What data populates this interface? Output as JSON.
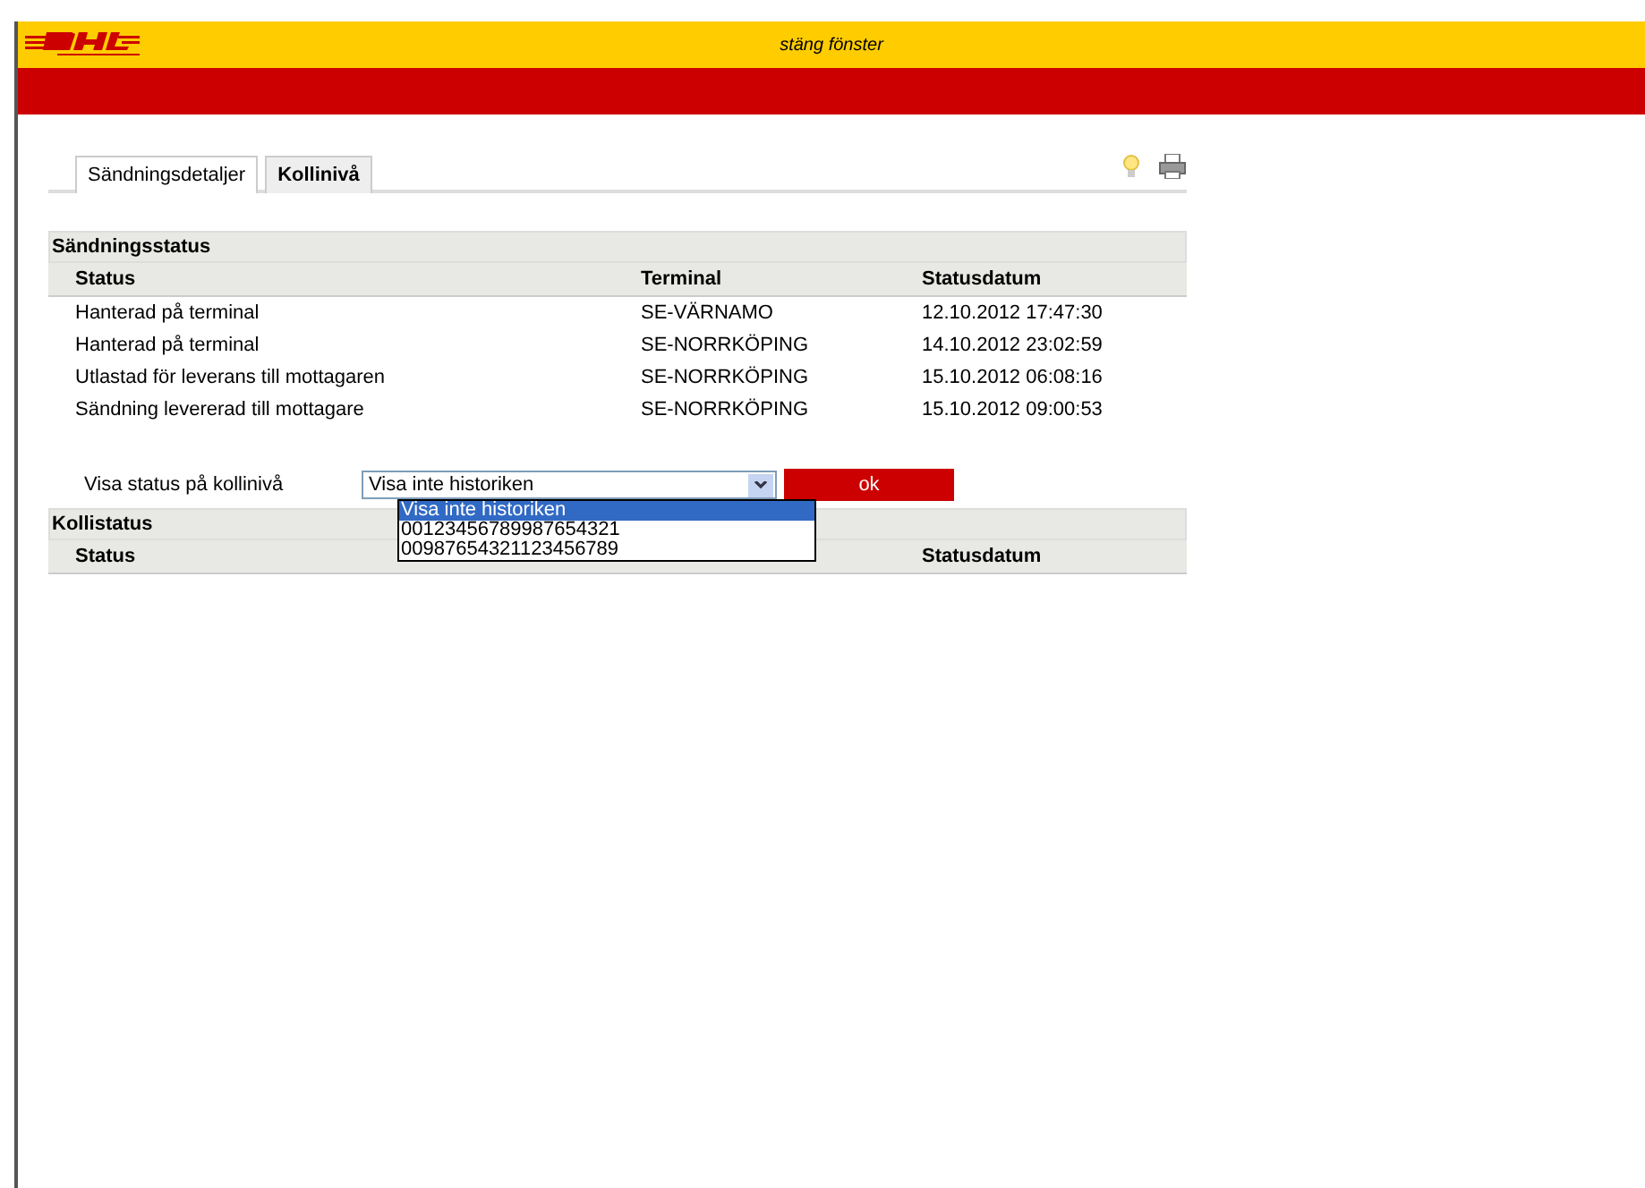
{
  "header": {
    "close_link": "stäng fönster"
  },
  "tabs": [
    {
      "label": "Sändningsdetaljer",
      "selected": false
    },
    {
      "label": "Kollinivå",
      "selected": true
    }
  ],
  "shipment_status": {
    "title": "Sändningsstatus",
    "columns": [
      "Status",
      "Terminal",
      "Statusdatum"
    ],
    "rows": [
      [
        "Hanterad på terminal",
        "SE-VÄRNAMO",
        "12.10.2012 17:47:30"
      ],
      [
        "Hanterad på terminal",
        "SE-NORRKÖPING",
        "14.10.2012 23:02:59"
      ],
      [
        "Utlastad för leverans till mottagaren",
        "SE-NORRKÖPING",
        "15.10.2012 06:08:16"
      ],
      [
        "Sändning levererad till mottagare",
        "SE-NORRKÖPING",
        "15.10.2012 09:00:53"
      ]
    ]
  },
  "package_filter": {
    "label": "Visa status på kollinivå",
    "value": "Visa inte historiken",
    "options": [
      {
        "label": "Visa inte historiken",
        "selected": true
      },
      {
        "label": "00123456789987654321",
        "selected": false
      },
      {
        "label": "00987654321123456789",
        "selected": false
      }
    ],
    "button": "ok"
  },
  "package_status": {
    "title": "Kollistatus",
    "columns": [
      "Status",
      "Statusdatum"
    ]
  }
}
